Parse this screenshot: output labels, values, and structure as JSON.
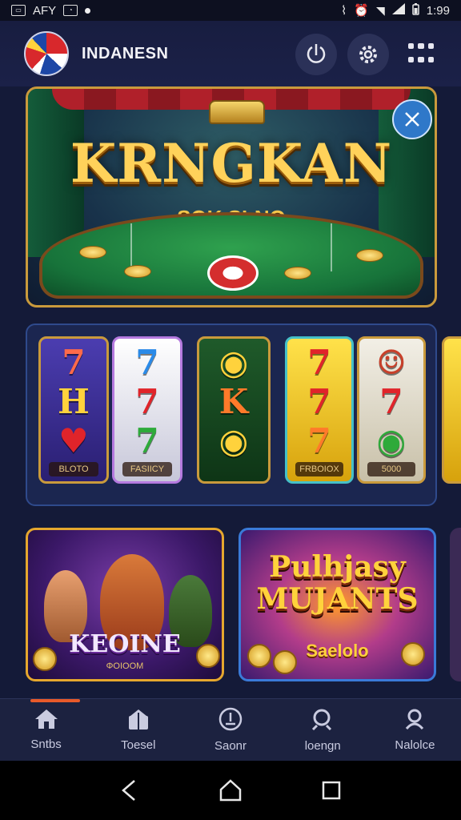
{
  "status_bar": {
    "carrier": "AFY",
    "time": "1:99"
  },
  "header": {
    "brand": "INDANESN"
  },
  "hero": {
    "title": "KRNGKAN",
    "subtitle": "SOK SLNO"
  },
  "slots": [
    {
      "symbols": [
        "7",
        "H",
        "♥"
      ],
      "label": "BLOTO",
      "colors": [
        "#ff6a4a",
        "#ffd23c",
        "#e0242a"
      ]
    },
    {
      "symbols": [
        "7",
        "7",
        "7"
      ],
      "label": "FASIICY",
      "colors": [
        "#2a8ae8",
        "#e0242a",
        "#2eaa3a"
      ]
    },
    {
      "symbols": [
        "◉",
        "K",
        "◉"
      ],
      "label": "",
      "colors": [
        "#ffd23c",
        "#ff7a2a",
        "#ffd23c"
      ]
    },
    {
      "symbols": [
        "7",
        "7",
        "7"
      ],
      "label": "FRBOIOX",
      "colors": [
        "#e0242a",
        "#e0242a",
        "#ff7a2a"
      ]
    },
    {
      "symbols": [
        "☺",
        "7",
        "◉"
      ],
      "label": "5000",
      "colors": [
        "#c8402a",
        "#e0242a",
        "#2eaa3a"
      ]
    }
  ],
  "cards": {
    "card1": {
      "title": "KEOINE",
      "subtitle": "ΦOIOOM"
    },
    "card2": {
      "title_line1": "Pulhjasy",
      "title_line2": "MUJANTS",
      "subtitle": "Saelolo"
    }
  },
  "tabs": [
    {
      "label": "Sntbs",
      "icon": "home-icon"
    },
    {
      "label": "Toesel",
      "icon": "gift-icon"
    },
    {
      "label": "Saonr",
      "icon": "download-icon"
    },
    {
      "label": "loengn",
      "icon": "search-icon"
    },
    {
      "label": "Nalolce",
      "icon": "profile-icon"
    }
  ],
  "colors": {
    "background": "#141a38",
    "accent_gold": "#c99a3c",
    "tab_indicator": "#e85a2a"
  }
}
